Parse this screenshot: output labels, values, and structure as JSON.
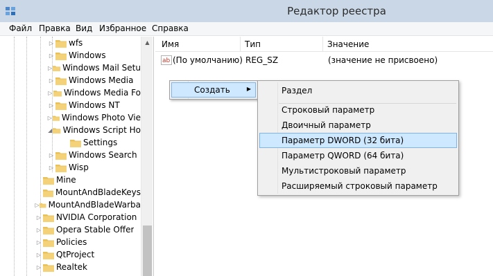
{
  "window": {
    "title": "Редактор реестра"
  },
  "menu": [
    "Файл",
    "Правка",
    "Вид",
    "Избранное",
    "Справка"
  ],
  "tree": [
    {
      "label": "wfs"
    },
    {
      "label": "Windows"
    },
    {
      "label": "Windows Mail Setu"
    },
    {
      "label": "Windows Media"
    },
    {
      "label": "Windows Media Fo"
    },
    {
      "label": "Windows NT"
    },
    {
      "label": "Windows Photo Vie"
    },
    {
      "label": "Windows Script Ho"
    },
    {
      "label": "Settings"
    },
    {
      "label": "Windows Search"
    },
    {
      "label": "Wisp"
    },
    {
      "label": "Mine"
    },
    {
      "label": "MountAndBladeKeys"
    },
    {
      "label": "MountAndBladeWarba"
    },
    {
      "label": "NVIDIA Corporation"
    },
    {
      "label": "Opera Stable Offer"
    },
    {
      "label": "Policies"
    },
    {
      "label": "QtProject"
    },
    {
      "label": "Realtek"
    }
  ],
  "columns": {
    "name": "Имя",
    "type": "Тип",
    "value": "Значение"
  },
  "rows": [
    {
      "icon": "string-value-icon",
      "name": "(По умолчанию)",
      "type": "REG_SZ",
      "value": "(значение не присвоено)"
    }
  ],
  "context_menu": {
    "create_label": "Создать"
  },
  "submenu": {
    "key": "Раздел",
    "items": [
      "Строковый параметр",
      "Двоичный параметр",
      "Параметр DWORD (32 бита)",
      "Параметр QWORD (64 бита)",
      "Мультистроковый параметр",
      "Расширяемый строковый параметр"
    ],
    "highlighted_index": 2
  },
  "colors": {
    "titlebar": "#c9d7e6",
    "highlight": "#cde8ff",
    "highlight_border": "#7eb4ea",
    "folder": "#e8c15a"
  }
}
